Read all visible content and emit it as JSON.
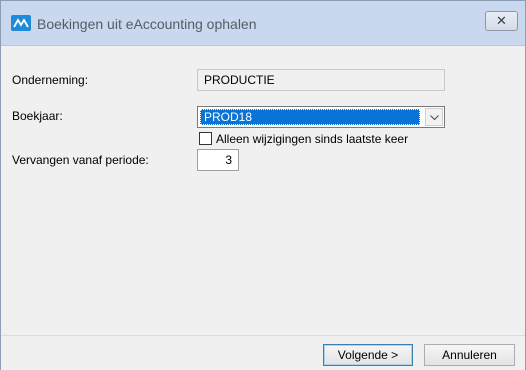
{
  "window": {
    "title": "Boekingen uit eAccounting ophalen",
    "close_label": "✕"
  },
  "form": {
    "onderneming": {
      "label": "Onderneming:",
      "value": "PRODUCTIE"
    },
    "boekjaar": {
      "label": "Boekjaar:",
      "value": "PROD18"
    },
    "alleen_wijzigingen": {
      "label": "Alleen wijzigingen sinds laatste keer",
      "checked": false
    },
    "vervangen_vanaf": {
      "label": "Vervangen vanaf periode:",
      "value": "3"
    }
  },
  "buttons": {
    "next_label": "Volgende >",
    "cancel_label": "Annuleren"
  },
  "colors": {
    "selection": "#0a74d6",
    "titlebar": "#c9d8ee",
    "app_icon": "#1f8ad8"
  }
}
